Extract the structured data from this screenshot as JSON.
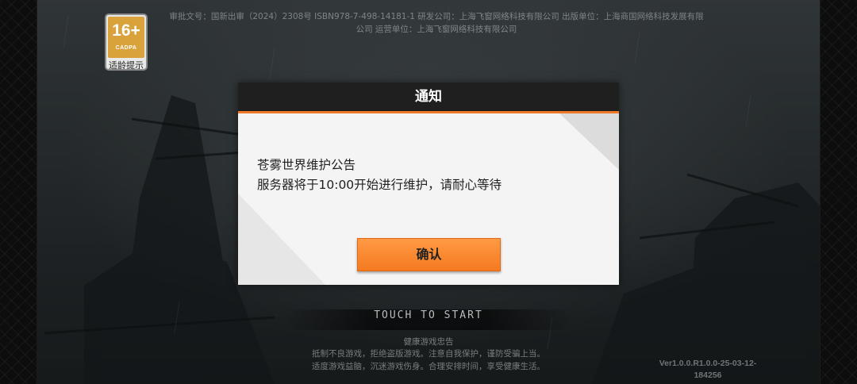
{
  "age_rating": {
    "number": "16+",
    "org": "CADPA",
    "label": "适龄提示"
  },
  "license_text": {
    "line1": "审批文号：国新出审（2024）2308号  ISBN978-7-498-14181-1 研发公司：上海飞窗网络科技有限公司  出版单位：上海商国网络科技发展有限",
    "line2": "公司  运营单位：上海飞窗网络科技有限公司"
  },
  "dialog": {
    "title": "通知",
    "body_line1": "苍雾世界维护公告",
    "body_line2": "服务器将于10:00开始进行维护，请耐心等待",
    "confirm_label": "确认"
  },
  "touch_to_start": "TOUCH TO START",
  "health_notice": {
    "title": "健康游戏忠告",
    "line1": "抵制不良游戏，拒绝盗版游戏。注意自我保护，谨防受骗上当。",
    "line2": "适度游戏益脑，沉迷游戏伤身。合理安排时间，享受健康生活。"
  },
  "version": {
    "line1": "Ver1.0.0.R1.0.0-25-03-12-",
    "line2": "184256"
  },
  "colors": {
    "accent": "#f47a20",
    "header": "#1f1f1f",
    "panel": "#f4f4f4"
  }
}
